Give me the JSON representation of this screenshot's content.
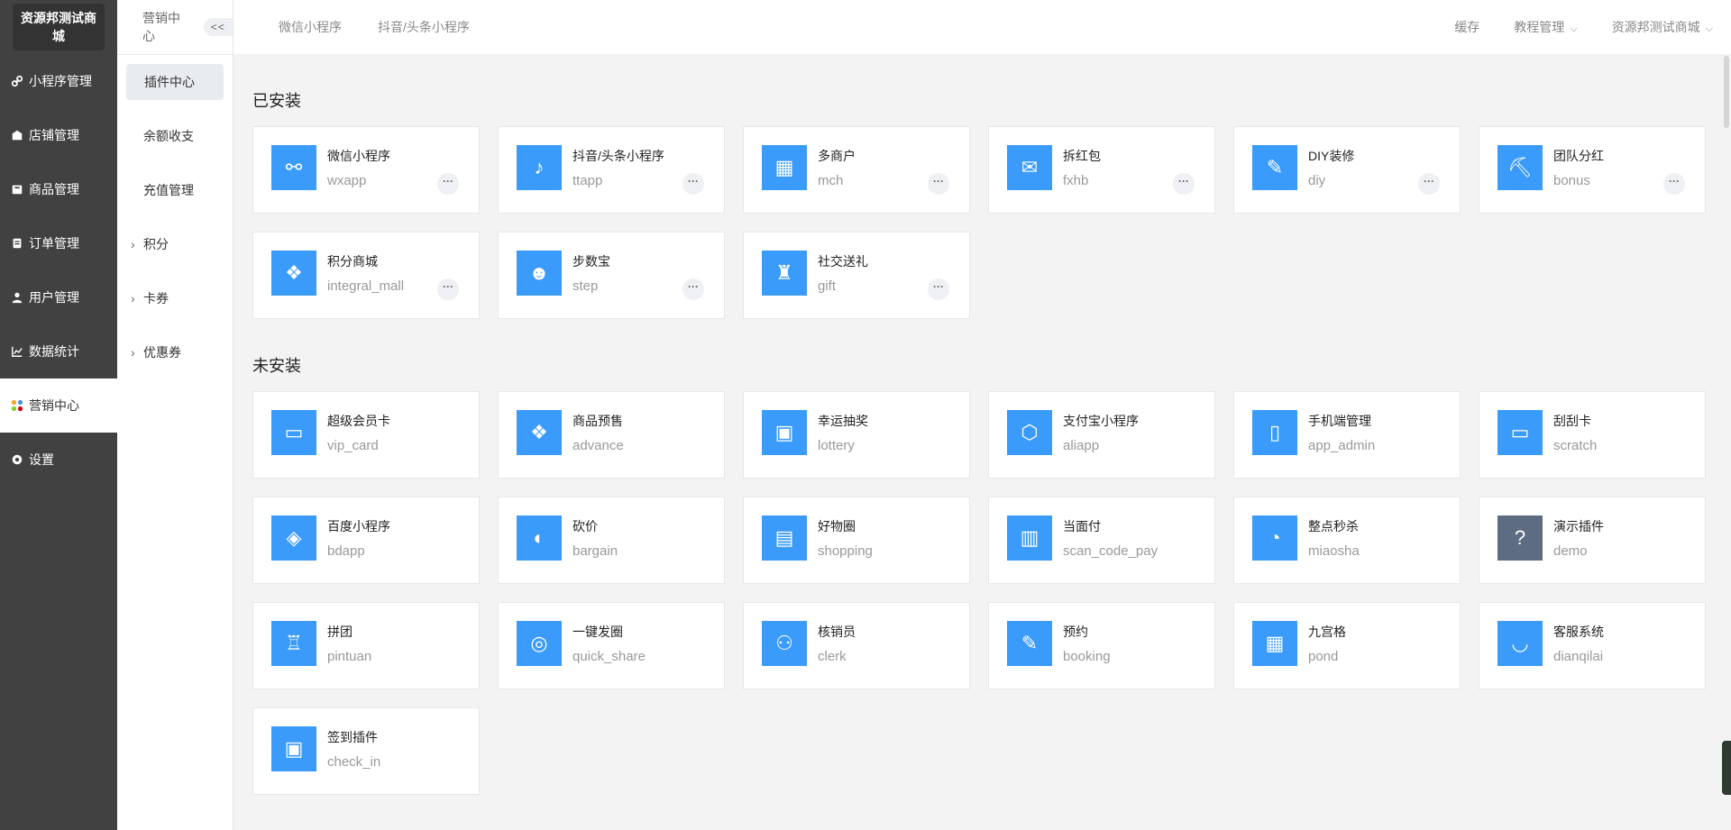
{
  "brand": "资源邦测试商城",
  "sidebar": {
    "items": [
      {
        "label": "小程序管理",
        "icon": "link-icon",
        "active": false
      },
      {
        "label": "店铺管理",
        "icon": "store-icon",
        "active": false
      },
      {
        "label": "商品管理",
        "icon": "goods-icon",
        "active": false
      },
      {
        "label": "订单管理",
        "icon": "order-icon",
        "active": false
      },
      {
        "label": "用户管理",
        "icon": "user-icon",
        "active": false
      },
      {
        "label": "数据统计",
        "icon": "chart-icon",
        "active": false
      },
      {
        "label": "营销中心",
        "icon": "marketing-icon",
        "active": true
      },
      {
        "label": "设置",
        "icon": "gear-icon",
        "active": false
      }
    ]
  },
  "subnav": {
    "title": "营销中心",
    "collapse": "<<",
    "items": [
      {
        "label": "插件中心",
        "active": true,
        "expandable": false
      },
      {
        "label": "余额收支",
        "active": false,
        "expandable": false
      },
      {
        "label": "充值管理",
        "active": false,
        "expandable": false
      },
      {
        "label": "积分",
        "active": false,
        "expandable": true
      },
      {
        "label": "卡券",
        "active": false,
        "expandable": true
      },
      {
        "label": "优惠券",
        "active": false,
        "expandable": true
      }
    ]
  },
  "topbar": {
    "tabs": [
      "微信小程序",
      "抖音/头条小程序"
    ],
    "right": {
      "cache": "缓存",
      "tutorial": "教程管理",
      "store": "资源邦测试商城"
    }
  },
  "installed": {
    "title": "已安装",
    "items": [
      {
        "name": "微信小程序",
        "key": "wxapp",
        "icon": "link-icon",
        "glyph": "⚯"
      },
      {
        "name": "抖音/头条小程序",
        "key": "ttapp",
        "icon": "douyin-icon",
        "glyph": "♪"
      },
      {
        "name": "多商户",
        "key": "mch",
        "icon": "multi-merchant-icon",
        "glyph": "▦"
      },
      {
        "name": "拆红包",
        "key": "fxhb",
        "icon": "red-packet-icon",
        "glyph": "✉"
      },
      {
        "name": "DIY装修",
        "key": "diy",
        "icon": "diy-icon",
        "glyph": "✎"
      },
      {
        "name": "团队分红",
        "key": "bonus",
        "icon": "team-bonus-icon",
        "glyph": "⛏"
      },
      {
        "name": "积分商城",
        "key": "integral_mall",
        "icon": "integral-mall-icon",
        "glyph": "❖"
      },
      {
        "name": "步数宝",
        "key": "step",
        "icon": "step-icon",
        "glyph": "☻"
      },
      {
        "name": "社交送礼",
        "key": "gift",
        "icon": "gift-icon",
        "glyph": "♜"
      }
    ],
    "more_label": "···"
  },
  "uninstalled": {
    "title": "未安装",
    "items": [
      {
        "name": "超级会员卡",
        "key": "vip_card",
        "icon": "vip-card-icon",
        "glyph": "▭"
      },
      {
        "name": "商品预售",
        "key": "advance",
        "icon": "presale-icon",
        "glyph": "❖"
      },
      {
        "name": "幸运抽奖",
        "key": "lottery",
        "icon": "lottery-icon",
        "glyph": "▣"
      },
      {
        "name": "支付宝小程序",
        "key": "aliapp",
        "icon": "alipay-icon",
        "glyph": "⬡"
      },
      {
        "name": "手机端管理",
        "key": "app_admin",
        "icon": "mobile-admin-icon",
        "glyph": "▯"
      },
      {
        "name": "刮刮卡",
        "key": "scratch",
        "icon": "scratch-card-icon",
        "glyph": "▭"
      },
      {
        "name": "百度小程序",
        "key": "bdapp",
        "icon": "baidu-icon",
        "glyph": "◈"
      },
      {
        "name": "砍价",
        "key": "bargain",
        "icon": "bargain-icon",
        "glyph": "◐"
      },
      {
        "name": "好物圈",
        "key": "shopping",
        "icon": "shopping-icon",
        "glyph": "▤"
      },
      {
        "name": "当面付",
        "key": "scan_code_pay",
        "icon": "scan-pay-icon",
        "glyph": "▥"
      },
      {
        "name": "整点秒杀",
        "key": "miaosha",
        "icon": "flash-sale-icon",
        "glyph": "◔"
      },
      {
        "name": "演示插件",
        "key": "demo",
        "icon": "question-icon",
        "glyph": "?",
        "gray": true
      },
      {
        "name": "拼团",
        "key": "pintuan",
        "icon": "group-buy-icon",
        "glyph": "♖"
      },
      {
        "name": "一键发圈",
        "key": "quick_share",
        "icon": "quick-share-icon",
        "glyph": "◎"
      },
      {
        "name": "核销员",
        "key": "clerk",
        "icon": "clerk-icon",
        "glyph": "⚇"
      },
      {
        "name": "预约",
        "key": "booking",
        "icon": "booking-icon",
        "glyph": "✎"
      },
      {
        "name": "九宫格",
        "key": "pond",
        "icon": "grid-nine-icon",
        "glyph": "▦"
      },
      {
        "name": "客服系统",
        "key": "dianqilai",
        "icon": "customer-service-icon",
        "glyph": "◡"
      },
      {
        "name": "签到插件",
        "key": "check_in",
        "icon": "check-in-icon",
        "glyph": "▣"
      }
    ]
  }
}
